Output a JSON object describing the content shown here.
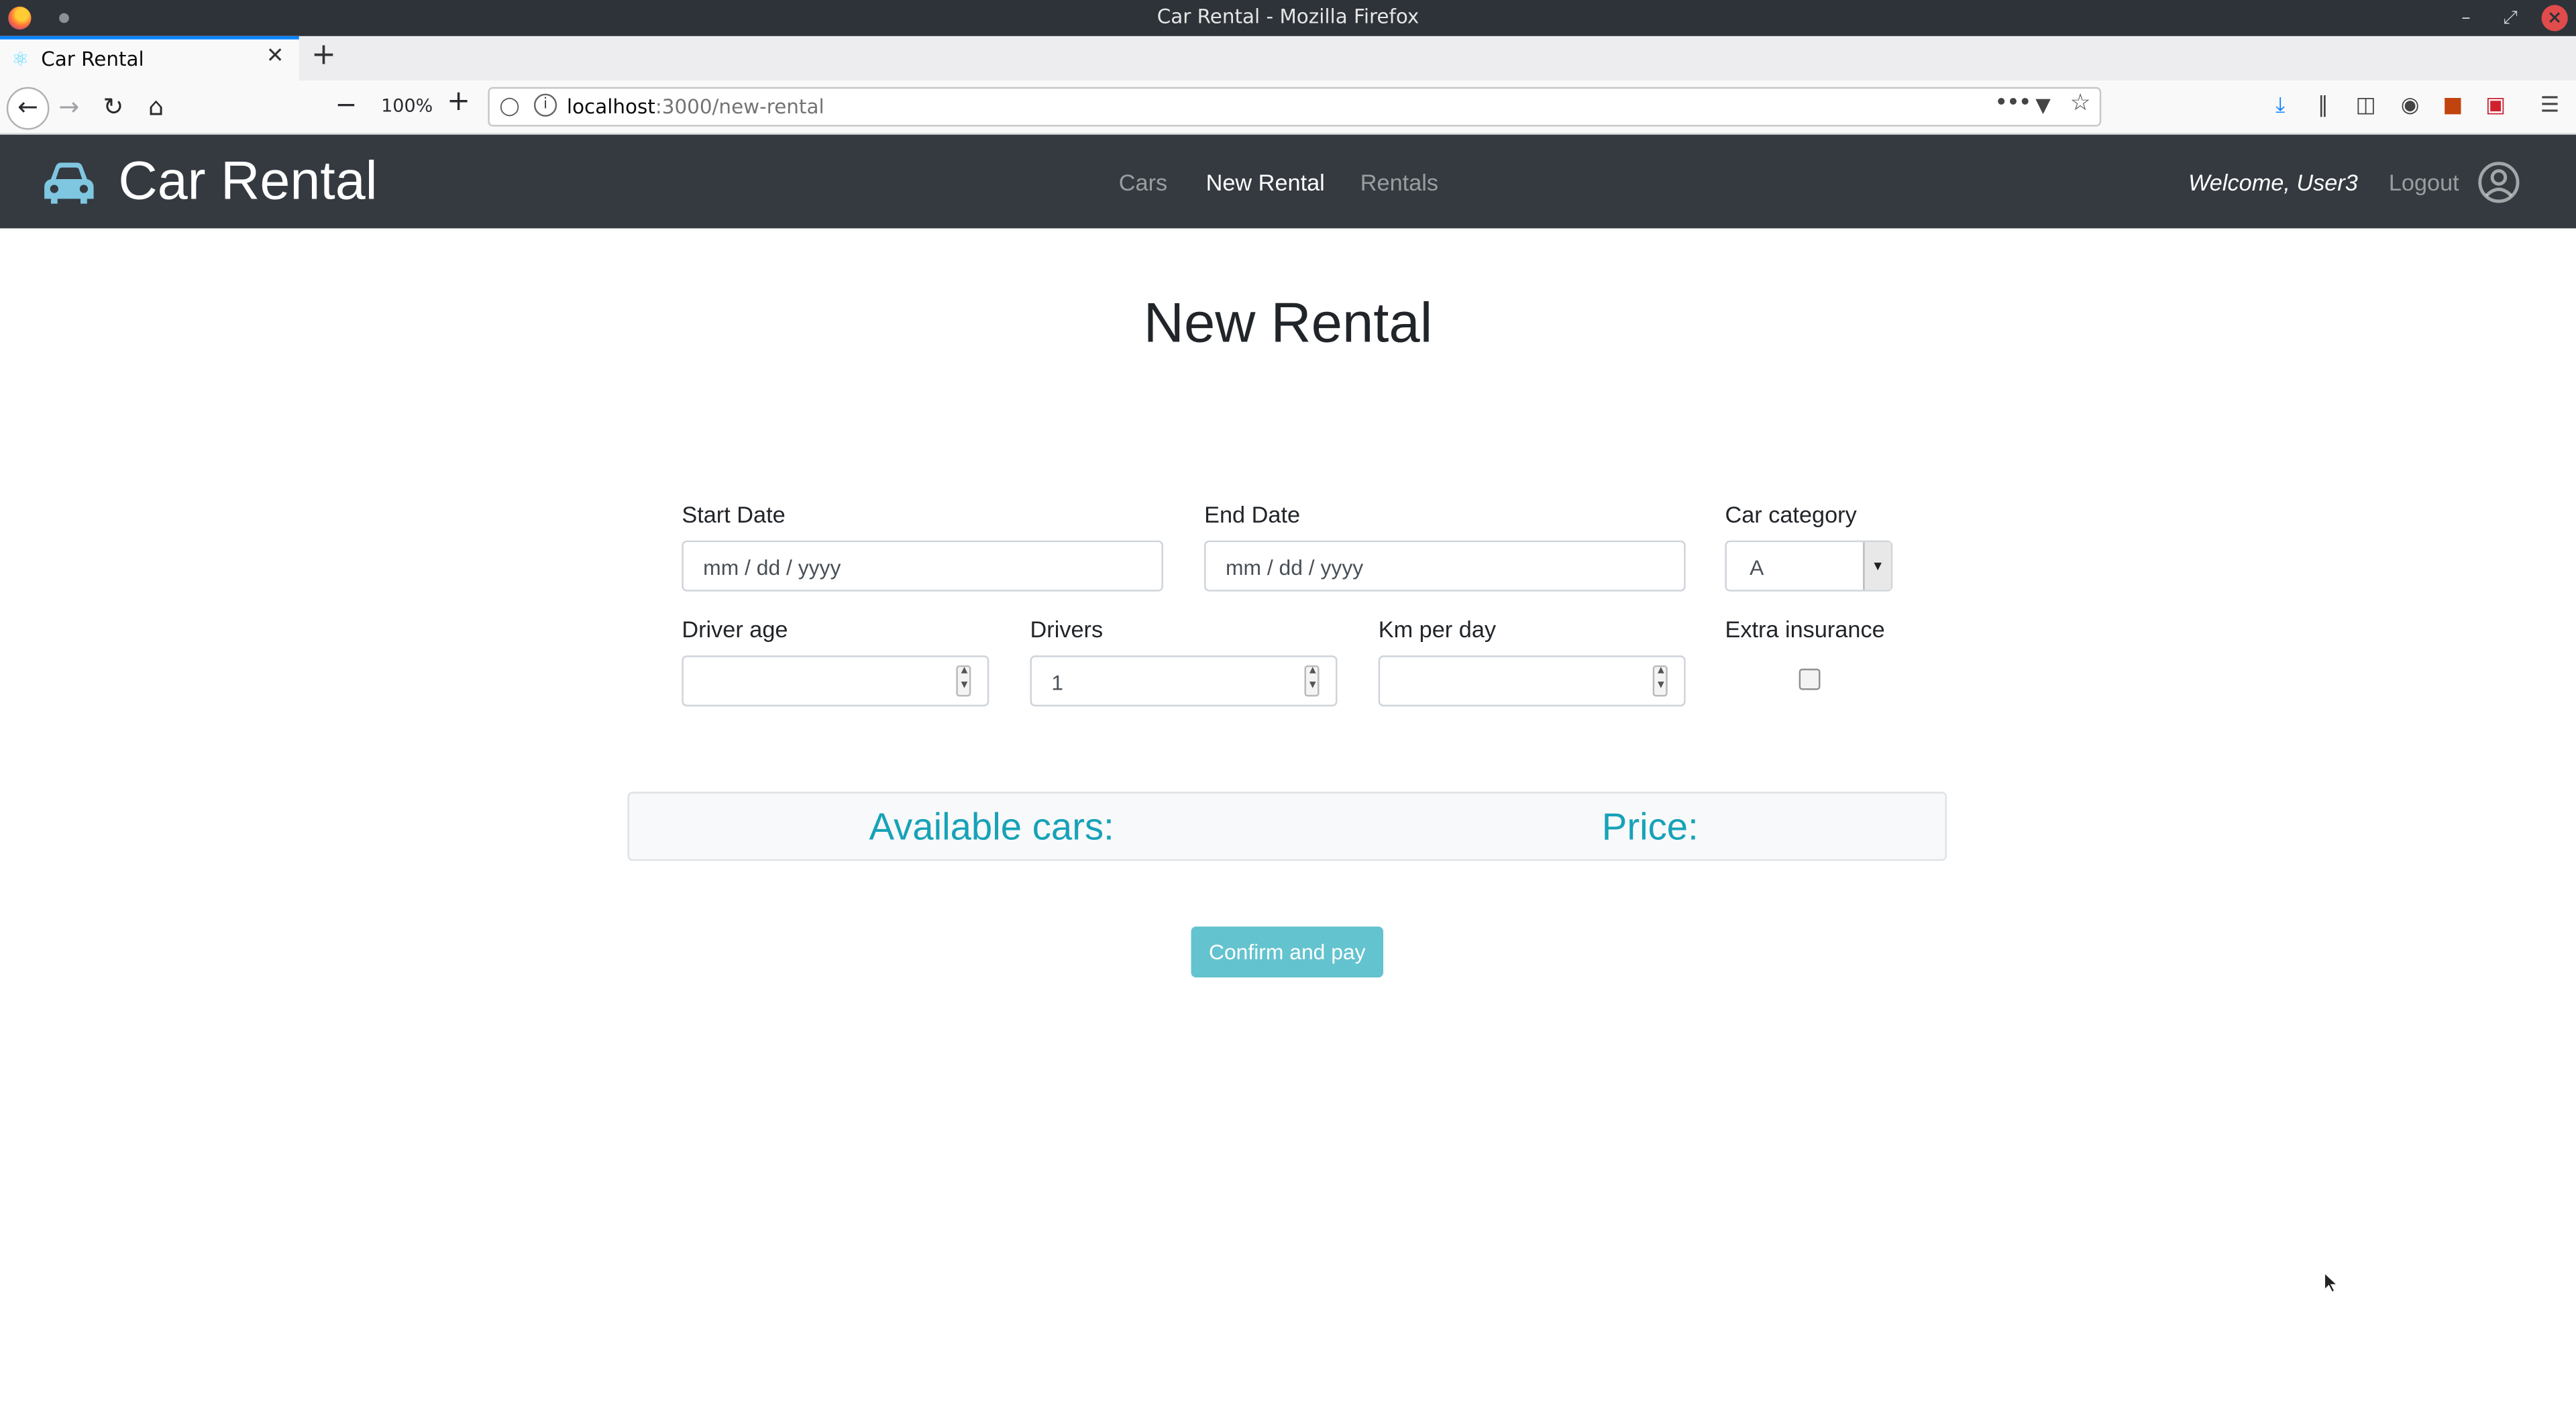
{
  "browser": {
    "window_title": "Car Rental - Mozilla Firefox",
    "tab_title": "Car Rental",
    "zoom": "100%",
    "url_host": "localhost",
    "url_path": ":3000/new-rental"
  },
  "app": {
    "brand": "Car Rental",
    "nav": {
      "cars": "Cars",
      "new_rental": "New Rental",
      "rentals": "Rentals"
    },
    "welcome": "Welcome, User3",
    "logout": "Logout"
  },
  "page": {
    "title": "New Rental",
    "form": {
      "start_date_label": "Start Date",
      "start_date_placeholder": "mm / dd / yyyy",
      "end_date_label": "End Date",
      "end_date_placeholder": "mm / dd / yyyy",
      "car_category_label": "Car category",
      "car_category_value": "A",
      "driver_age_label": "Driver age",
      "driver_age_value": "",
      "drivers_label": "Drivers",
      "drivers_value": "1",
      "km_per_day_label": "Km per day",
      "km_per_day_value": "",
      "extra_insurance_label": "Extra insurance",
      "extra_insurance_checked": false
    },
    "summary": {
      "available_cars_label": "Available cars:",
      "price_label": "Price:"
    },
    "confirm_button": "Confirm and pay"
  },
  "colors": {
    "navbar_bg": "#343a40",
    "accent": "#17a2b8",
    "button": "#5bc0cc"
  }
}
